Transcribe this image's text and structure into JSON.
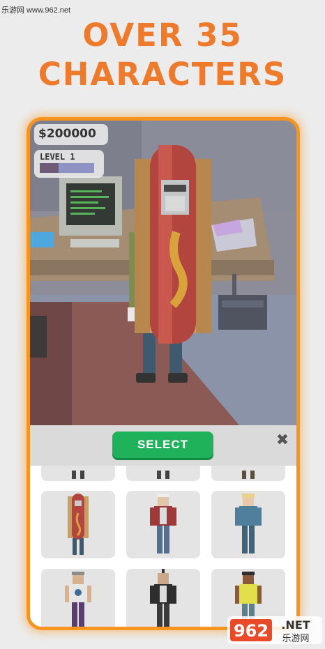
{
  "watermark_top": "乐游网 www.962.net",
  "headline": {
    "line1": "OVER 35",
    "line2": "CHARACTERS"
  },
  "hud": {
    "money": "$200000",
    "level_label": "LEVEL 1",
    "level_progress": 0.35
  },
  "panel": {
    "select_label": "SELECT",
    "close_glyph": "✖"
  },
  "characters": [
    {
      "name": "partial-top-1"
    },
    {
      "name": "partial-top-2"
    },
    {
      "name": "partial-top-3"
    },
    {
      "name": "hotdog-costume"
    },
    {
      "name": "white-hair-red-jacket"
    },
    {
      "name": "blonde-blue-outfit"
    },
    {
      "name": "purple-outfit"
    },
    {
      "name": "mohawk-black-jacket"
    },
    {
      "name": "yellow-vest"
    }
  ],
  "watermark_bottom": {
    "num": "962",
    "suffix": ".NET",
    "cn": "乐游网"
  },
  "colors": {
    "accent": "#ee7a2c",
    "frame": "#f7941d",
    "select": "#1fb25a"
  }
}
